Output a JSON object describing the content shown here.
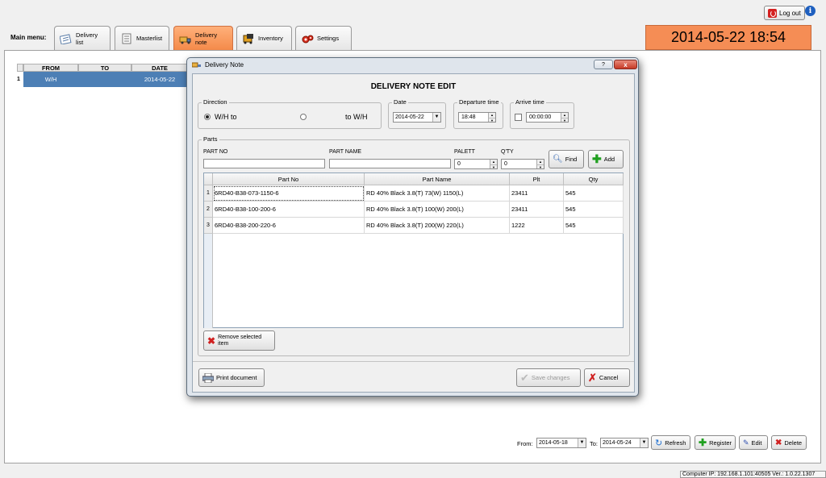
{
  "top": {
    "logout_label": "Log out",
    "info_icon": "i"
  },
  "main_menu": {
    "label": "Main menu:",
    "tabs": [
      {
        "label": "Delivery list",
        "icon": "delivery-list-icon"
      },
      {
        "label": "Masterlist",
        "icon": "masterlist-icon"
      },
      {
        "label": "Delivery note",
        "icon": "delivery-note-icon",
        "active": true
      },
      {
        "label": "Inventory",
        "icon": "inventory-icon"
      },
      {
        "label": "Settings",
        "icon": "settings-icon"
      }
    ]
  },
  "clock": "2014-05-22 18:54",
  "grid": {
    "headers": [
      "FROM",
      "TO",
      "DATE"
    ],
    "rows": [
      {
        "num": "1",
        "from": "W/H",
        "to": "",
        "date": "2014-05-22"
      }
    ]
  },
  "toolbar": {
    "from_label": "From:",
    "from_date": "2014-05-18",
    "to_label": "To:",
    "to_date": "2014-05-24",
    "refresh": "Refresh",
    "register": "Register",
    "edit": "Edit",
    "delete": "Delete"
  },
  "status": "Computer IP: 192.168.1.101:40505   Ver.: 1.0.22.1307",
  "dialog": {
    "title": "Delivery Note",
    "help": "?",
    "close": "x",
    "heading": "DELIVERY NOTE EDIT",
    "direction": {
      "label": "Direction",
      "option1": "W/H to",
      "option2": "to W/H"
    },
    "date": {
      "label": "Date",
      "value": "2014-05-22"
    },
    "departure": {
      "label": "Departure time",
      "value": "18:48"
    },
    "arrive": {
      "label": "Arrive time",
      "value": "00:00:00"
    },
    "parts": {
      "label": "Parts",
      "part_no_label": "PART NO",
      "part_name_label": "PART NAME",
      "palett_label": "PALETT",
      "palett_value": "0",
      "qty_label": "Q'TY",
      "qty_value": "0",
      "find": "Find",
      "add": "Add",
      "columns": [
        "Part No",
        "Part Name",
        "Plt",
        "Qty"
      ],
      "rows": [
        {
          "n": "1",
          "part_no": "6RD40-B38-073-1150-6",
          "part_name": "RD 40% Black 3.8(T) 73(W) 1150(L)",
          "plt": "23411",
          "qty": "545"
        },
        {
          "n": "2",
          "part_no": "6RD40-B38-100-200-6",
          "part_name": "RD 40% Black 3.8(T) 100(W) 200(L)",
          "plt": "23411",
          "qty": "545"
        },
        {
          "n": "3",
          "part_no": "6RD40-B38-200-220-6",
          "part_name": "RD 40% Black 3.8(T) 200(W) 220(L)",
          "plt": "1222",
          "qty": "545"
        }
      ],
      "remove_line1": "Remove selected",
      "remove_line2": "item"
    },
    "print": "Print document",
    "save": "Save changes",
    "cancel": "Cancel"
  }
}
